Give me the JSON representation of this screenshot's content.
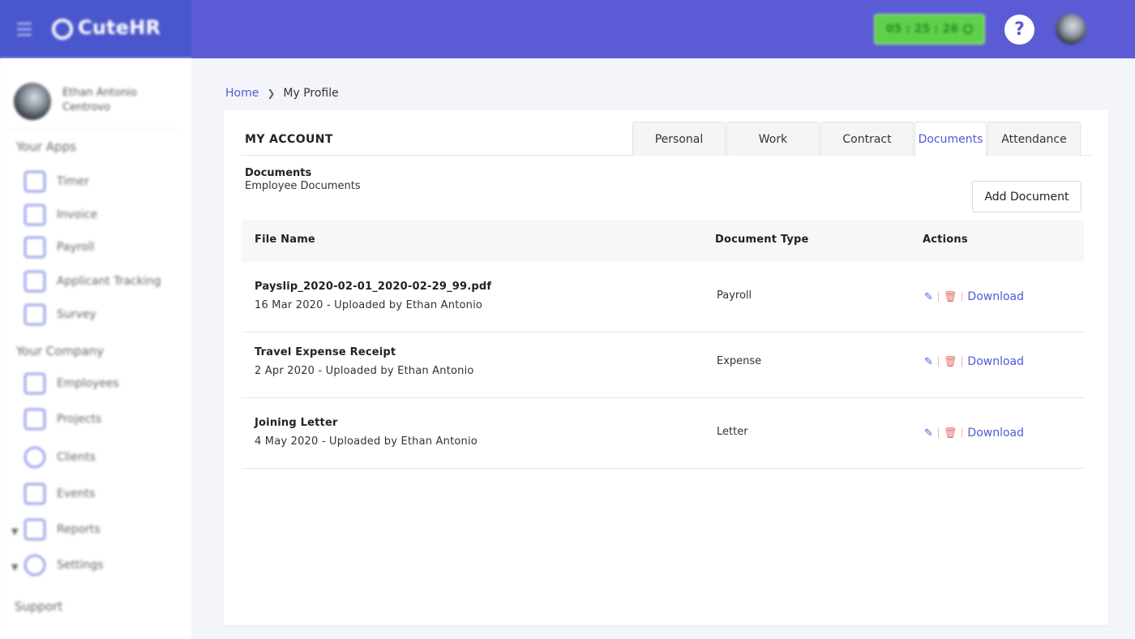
{
  "brand": {
    "name": "CuteHR"
  },
  "header": {
    "timer": "05 : 25 : 26",
    "help_label": "?"
  },
  "user": {
    "name": "Ethan Antonio Centrovo"
  },
  "sidebar": {
    "apps_heading": "Your Apps",
    "apps": [
      {
        "label": "Timer",
        "icon": "timer-icon"
      },
      {
        "label": "Invoice",
        "icon": "invoice-icon"
      },
      {
        "label": "Payroll",
        "icon": "payroll-icon"
      },
      {
        "label": "Applicant Tracking",
        "icon": "applicant-tracking-icon"
      },
      {
        "label": "Survey",
        "icon": "survey-icon"
      }
    ],
    "company_heading": "Your Company",
    "company": [
      {
        "label": "Employees",
        "icon": "employees-icon"
      },
      {
        "label": "Projects",
        "icon": "projects-icon"
      },
      {
        "label": "Clients",
        "icon": "clients-icon"
      },
      {
        "label": "Events",
        "icon": "events-icon"
      },
      {
        "label": "Reports",
        "icon": "reports-icon"
      },
      {
        "label": "Settings",
        "icon": "settings-icon"
      }
    ],
    "support_heading": "Support"
  },
  "breadcrumb": {
    "home": "Home",
    "current": "My Profile"
  },
  "account": {
    "title": "MY ACCOUNT",
    "tabs": [
      {
        "label": "Personal"
      },
      {
        "label": "Work"
      },
      {
        "label": "Contract"
      },
      {
        "label": "Documents"
      },
      {
        "label": "Attendance"
      }
    ],
    "active_tab": "Documents"
  },
  "documents": {
    "title": "Documents",
    "subtitle": "Employee Documents",
    "add_button": "Add Document",
    "columns": {
      "file_name": "File Name",
      "document_type": "Document Type",
      "actions": "Actions"
    },
    "rows": [
      {
        "file_name": "Payslip_2020-02-01_2020-02-29_99.pdf",
        "meta": "16 Mar 2020 - Uploaded by Ethan Antonio",
        "type": "Payroll",
        "download": "Download"
      },
      {
        "file_name": "Travel Expense Receipt",
        "meta": "2 Apr 2020 - Uploaded by Ethan Antonio",
        "type": "Expense",
        "download": "Download"
      },
      {
        "file_name": "Joining Letter",
        "meta": "4 May 2020 - Uploaded by Ethan Antonio",
        "type": "Letter",
        "download": "Download"
      }
    ]
  },
  "colors": {
    "primary": "#5b5bd6",
    "brand_dark": "#4a56cc",
    "link": "#4f5bd5",
    "timer_green": "#5ed04a",
    "delete_red": "#e46a6a"
  }
}
